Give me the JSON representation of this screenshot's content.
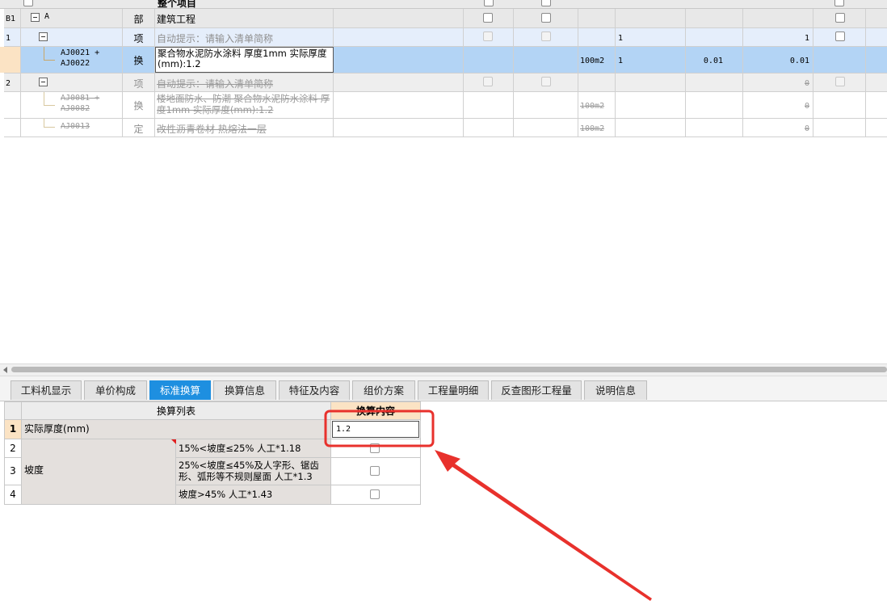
{
  "header": {
    "partial_title": "整个项目"
  },
  "rows": [
    {
      "no": "B1",
      "code": "A",
      "type": "部",
      "name": "建筑工程"
    },
    {
      "no": "1",
      "code": "",
      "type": "项",
      "name": "自动提示：请输入清单简称",
      "qty": "1",
      "total": "1"
    },
    {
      "no": "",
      "code_line1": "AJ0021 +",
      "code_line2": "AJ0022",
      "type": "换",
      "name": "聚合物水泥防水涂料 厚度1mm  实际厚度(mm):1.2",
      "unit": "100m2",
      "qty": "1",
      "price": "0.01",
      "total": "0.01"
    },
    {
      "no": "2",
      "code": "",
      "type": "项",
      "name": "自动提示：请输入清单简称",
      "total": "0"
    },
    {
      "no": "",
      "code_line1": "AJ0081 +",
      "code_line2": "AJ0082",
      "type": "换",
      "name": "楼地面防水、防潮 聚合物水泥防水涂料 厚度1mm  实际厚度(mm):1.2",
      "unit": "100m2",
      "total": "0"
    },
    {
      "no": "",
      "code": "AJ0013",
      "type": "定",
      "name": "改性沥青卷材 热熔法一层",
      "unit": "100m2",
      "total": "0"
    }
  ],
  "tabs": [
    "工料机显示",
    "单价构成",
    "标准换算",
    "换算信息",
    "特征及内容",
    "组价方案",
    "工程量明细",
    "反查图形工程量",
    "说明信息"
  ],
  "active_tab": "标准换算",
  "conversion": {
    "col_list": "换算列表",
    "col_content": "换算内容",
    "rows": [
      {
        "no": "1",
        "label": "实际厚度(mm)",
        "value": "1.2"
      },
      {
        "no": "2",
        "group": "坡度",
        "label": "15%<坡度≤25% 人工*1.18"
      },
      {
        "no": "3",
        "label": "25%<坡度≤45%及人字形、锯齿形、弧形等不规则屋面 人工*1.3"
      },
      {
        "no": "4",
        "label": "坡度>45% 人工*1.43"
      }
    ]
  },
  "colors": {
    "selected_row": "#b3d4f5",
    "section_row": "#e8e8e8",
    "accent_tab": "#1e8fe0",
    "annotation": "#e8312c"
  }
}
